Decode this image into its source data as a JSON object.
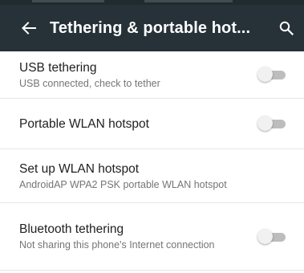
{
  "toolbar": {
    "title": "Tethering & portable hot...",
    "back_icon": "arrow-back-icon",
    "search_icon": "search-icon",
    "background": "#263238"
  },
  "settings": [
    {
      "title": "USB tethering",
      "summary": "USB connected, check to tether",
      "has_switch": true,
      "switch_on": false
    },
    {
      "title": "Portable WLAN hotspot",
      "summary": "",
      "has_switch": true,
      "switch_on": false
    },
    {
      "title": "Set up WLAN hotspot",
      "summary": "AndroidAP WPA2 PSK portable WLAN hotspot",
      "has_switch": false
    },
    {
      "title": "Bluetooth tethering",
      "summary": "Not sharing this phone's Internet connection",
      "has_switch": true,
      "switch_on": false
    }
  ]
}
